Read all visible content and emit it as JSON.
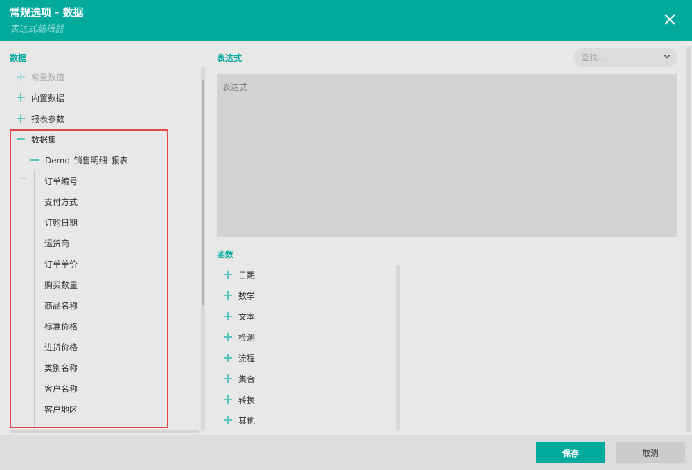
{
  "header": {
    "title": "常规选项 - 数据",
    "subtitle": "表达式编辑器"
  },
  "left": {
    "section_label": "数据",
    "tree": [
      {
        "label": "常量数值",
        "state": "collapsed",
        "disabled": true
      },
      {
        "label": "内置数据",
        "state": "collapsed"
      },
      {
        "label": "报表参数",
        "state": "collapsed"
      },
      {
        "label": "数据集",
        "state": "expanded"
      },
      {
        "label": "Demo_销售明细_报表",
        "state": "expanded"
      },
      {
        "label": "订单编号"
      },
      {
        "label": "支付方式"
      },
      {
        "label": "订购日期"
      },
      {
        "label": "运货商"
      },
      {
        "label": "订单单价"
      },
      {
        "label": "购买数量"
      },
      {
        "label": "商品名称"
      },
      {
        "label": "标准价格"
      },
      {
        "label": "进货价格"
      },
      {
        "label": "类别名称"
      },
      {
        "label": "客户名称"
      },
      {
        "label": "客户地区"
      }
    ]
  },
  "right": {
    "expression_label": "表达式",
    "search_placeholder": "查找...",
    "expression_placeholder": "表达式",
    "functions_label": "函数",
    "functions": [
      "日期",
      "数学",
      "文本",
      "检测",
      "流程",
      "集合",
      "转换",
      "其他"
    ]
  },
  "footer": {
    "save_label": "保存",
    "cancel_label": "取消"
  },
  "colors": {
    "accent": "#02a99d",
    "highlight": "#e04848"
  }
}
